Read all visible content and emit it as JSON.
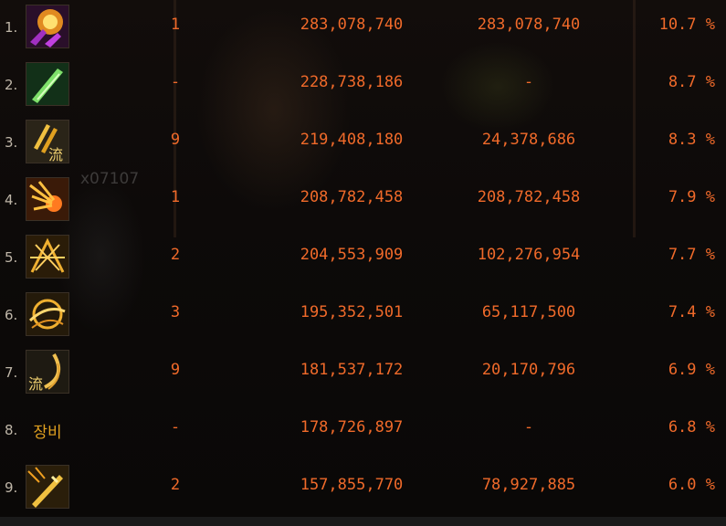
{
  "background_text": "x07107",
  "rows": [
    {
      "rank": "1.",
      "icon": "purple-explosion-skill-icon",
      "icon_label": "",
      "level": "1",
      "total": "283,078,740",
      "per_hit": "283,078,740",
      "percent": "10.7 %"
    },
    {
      "rank": "2.",
      "icon": "green-blade-skill-icon",
      "icon_label": "",
      "level": "-",
      "total": "228,738,186",
      "per_hit": "-",
      "percent": "8.7 %"
    },
    {
      "rank": "3.",
      "icon": "flowing-strike-skill-icon",
      "icon_label": "",
      "level": "9",
      "total": "219,408,180",
      "per_hit": "24,378,686",
      "percent": "8.3 %"
    },
    {
      "rank": "4.",
      "icon": "fire-burst-skill-icon",
      "icon_label": "",
      "level": "1",
      "total": "208,782,458",
      "per_hit": "208,782,458",
      "percent": "7.9 %"
    },
    {
      "rank": "5.",
      "icon": "lightning-cross-skill-icon",
      "icon_label": "",
      "level": "2",
      "total": "204,553,909",
      "per_hit": "102,276,954",
      "percent": "7.7 %"
    },
    {
      "rank": "6.",
      "icon": "spiral-slash-skill-icon",
      "icon_label": "",
      "level": "3",
      "total": "195,352,501",
      "per_hit": "65,117,500",
      "percent": "7.4 %"
    },
    {
      "rank": "7.",
      "icon": "flowing-wave-skill-icon",
      "icon_label": "",
      "level": "9",
      "total": "181,537,172",
      "per_hit": "20,170,796",
      "percent": "6.9 %"
    },
    {
      "rank": "8.",
      "icon": "equipment-label-icon",
      "icon_label": "장비",
      "level": "-",
      "total": "178,726,897",
      "per_hit": "-",
      "percent": "6.8 %"
    },
    {
      "rank": "9.",
      "icon": "sword-strike-skill-icon",
      "icon_label": "",
      "level": "2",
      "total": "157,855,770",
      "per_hit": "78,927,885",
      "percent": "6.0 %"
    }
  ],
  "colors": {
    "value": "#f06a2a",
    "rank": "#bfb6a8",
    "label": "#e0a020"
  }
}
